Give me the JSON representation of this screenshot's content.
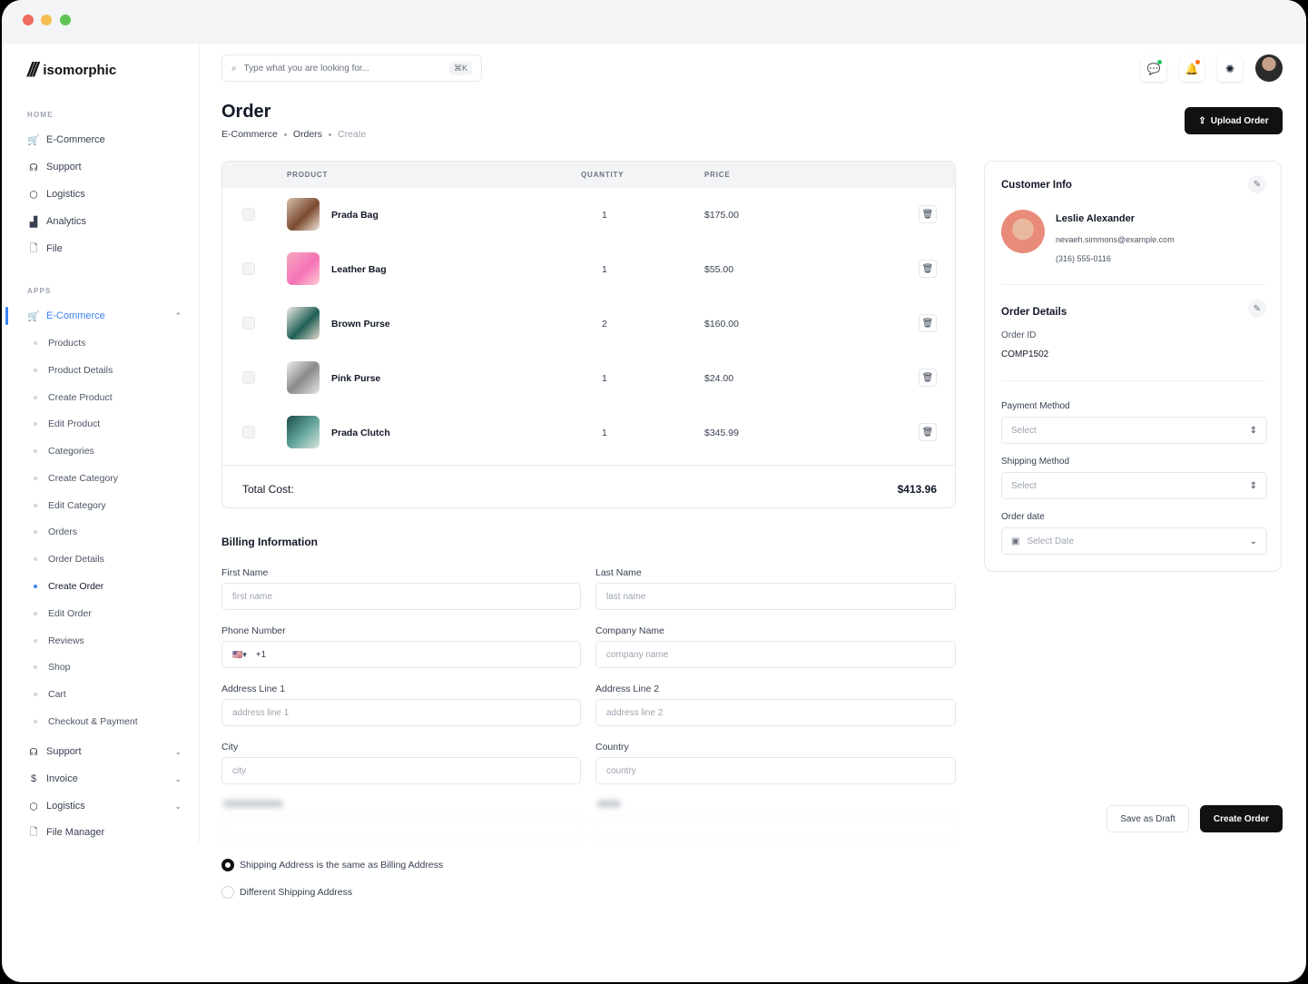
{
  "brand": {
    "name": "isomorphic"
  },
  "sidebar": {
    "home_label": "HOME",
    "home_items": [
      {
        "label": "E-Commerce",
        "icon": "cart-icon"
      },
      {
        "label": "Support",
        "icon": "headset-icon"
      },
      {
        "label": "Logistics",
        "icon": "box-icon"
      },
      {
        "label": "Analytics",
        "icon": "chart-icon"
      },
      {
        "label": "File",
        "icon": "file-icon"
      }
    ],
    "apps_label": "APPS",
    "apps_active": {
      "label": "E-Commerce",
      "icon": "cart-icon"
    },
    "sub_items": [
      "Products",
      "Product Details",
      "Create Product",
      "Edit Product",
      "Categories",
      "Create Category",
      "Edit Category",
      "Orders",
      "Order Details",
      "Create Order",
      "Edit Order",
      "Reviews",
      "Shop",
      "Cart",
      "Checkout & Payment"
    ],
    "current_sub": "Create Order",
    "bottom_items": [
      {
        "label": "Support",
        "icon": "headset-icon"
      },
      {
        "label": "Invoice",
        "icon": "dollar-icon"
      },
      {
        "label": "Logistics",
        "icon": "box-icon"
      },
      {
        "label": "File Manager",
        "icon": "file-icon"
      }
    ]
  },
  "search": {
    "placeholder": "Type what you are looking for...",
    "shortcut": "⌘K"
  },
  "page": {
    "title": "Order",
    "breadcrumbs": [
      "E-Commerce",
      "Orders",
      "Create"
    ],
    "upload_button": "Upload Order"
  },
  "table": {
    "headers": {
      "product": "PRODUCT",
      "quantity": "QUANTITY",
      "price": "PRICE"
    },
    "rows": [
      {
        "name": "Prada Bag",
        "quantity": "1",
        "price": "$175.00"
      },
      {
        "name": "Leather Bag",
        "quantity": "1",
        "price": "$55.00"
      },
      {
        "name": "Brown Purse",
        "quantity": "2",
        "price": "$160.00"
      },
      {
        "name": "Pink Purse",
        "quantity": "1",
        "price": "$24.00"
      },
      {
        "name": "Prada Clutch",
        "quantity": "1",
        "price": "$345.99"
      }
    ],
    "total_label": "Total Cost:",
    "total_value": "$413.96"
  },
  "billing": {
    "title": "Billing Information",
    "first_name": {
      "label": "First Name",
      "placeholder": "first name"
    },
    "last_name": {
      "label": "Last Name",
      "placeholder": "last name"
    },
    "phone": {
      "label": "Phone Number",
      "prefix": "+1"
    },
    "company": {
      "label": "Company Name",
      "placeholder": "company name"
    },
    "address1": {
      "label": "Address Line 1",
      "placeholder": "address line 1"
    },
    "address2": {
      "label": "Address Line 2",
      "placeholder": "address line 2"
    },
    "city": {
      "label": "City",
      "placeholder": "city"
    },
    "country": {
      "label": "Country",
      "placeholder": "country"
    }
  },
  "shipping_options": {
    "same": "Shipping Address is the same as Billing Address",
    "different": "Different Shipping Address"
  },
  "customer": {
    "title": "Customer Info",
    "name": "Leslie Alexander",
    "email": "nevaeh.simmons@example.com",
    "phone": "(316) 555-0116"
  },
  "order_details": {
    "title": "Order Details",
    "id_label": "Order ID",
    "id_value": "COMP1502",
    "payment_label": "Payment Method",
    "payment_value": "Select",
    "shipping_label": "Shipping Method",
    "shipping_value": "Select",
    "date_label": "Order date",
    "date_value": "Select Date"
  },
  "actions": {
    "draft": "Save as Draft",
    "create": "Create Order"
  },
  "colors": {
    "accent": "#3b82f6",
    "dark_button": "#111111"
  }
}
